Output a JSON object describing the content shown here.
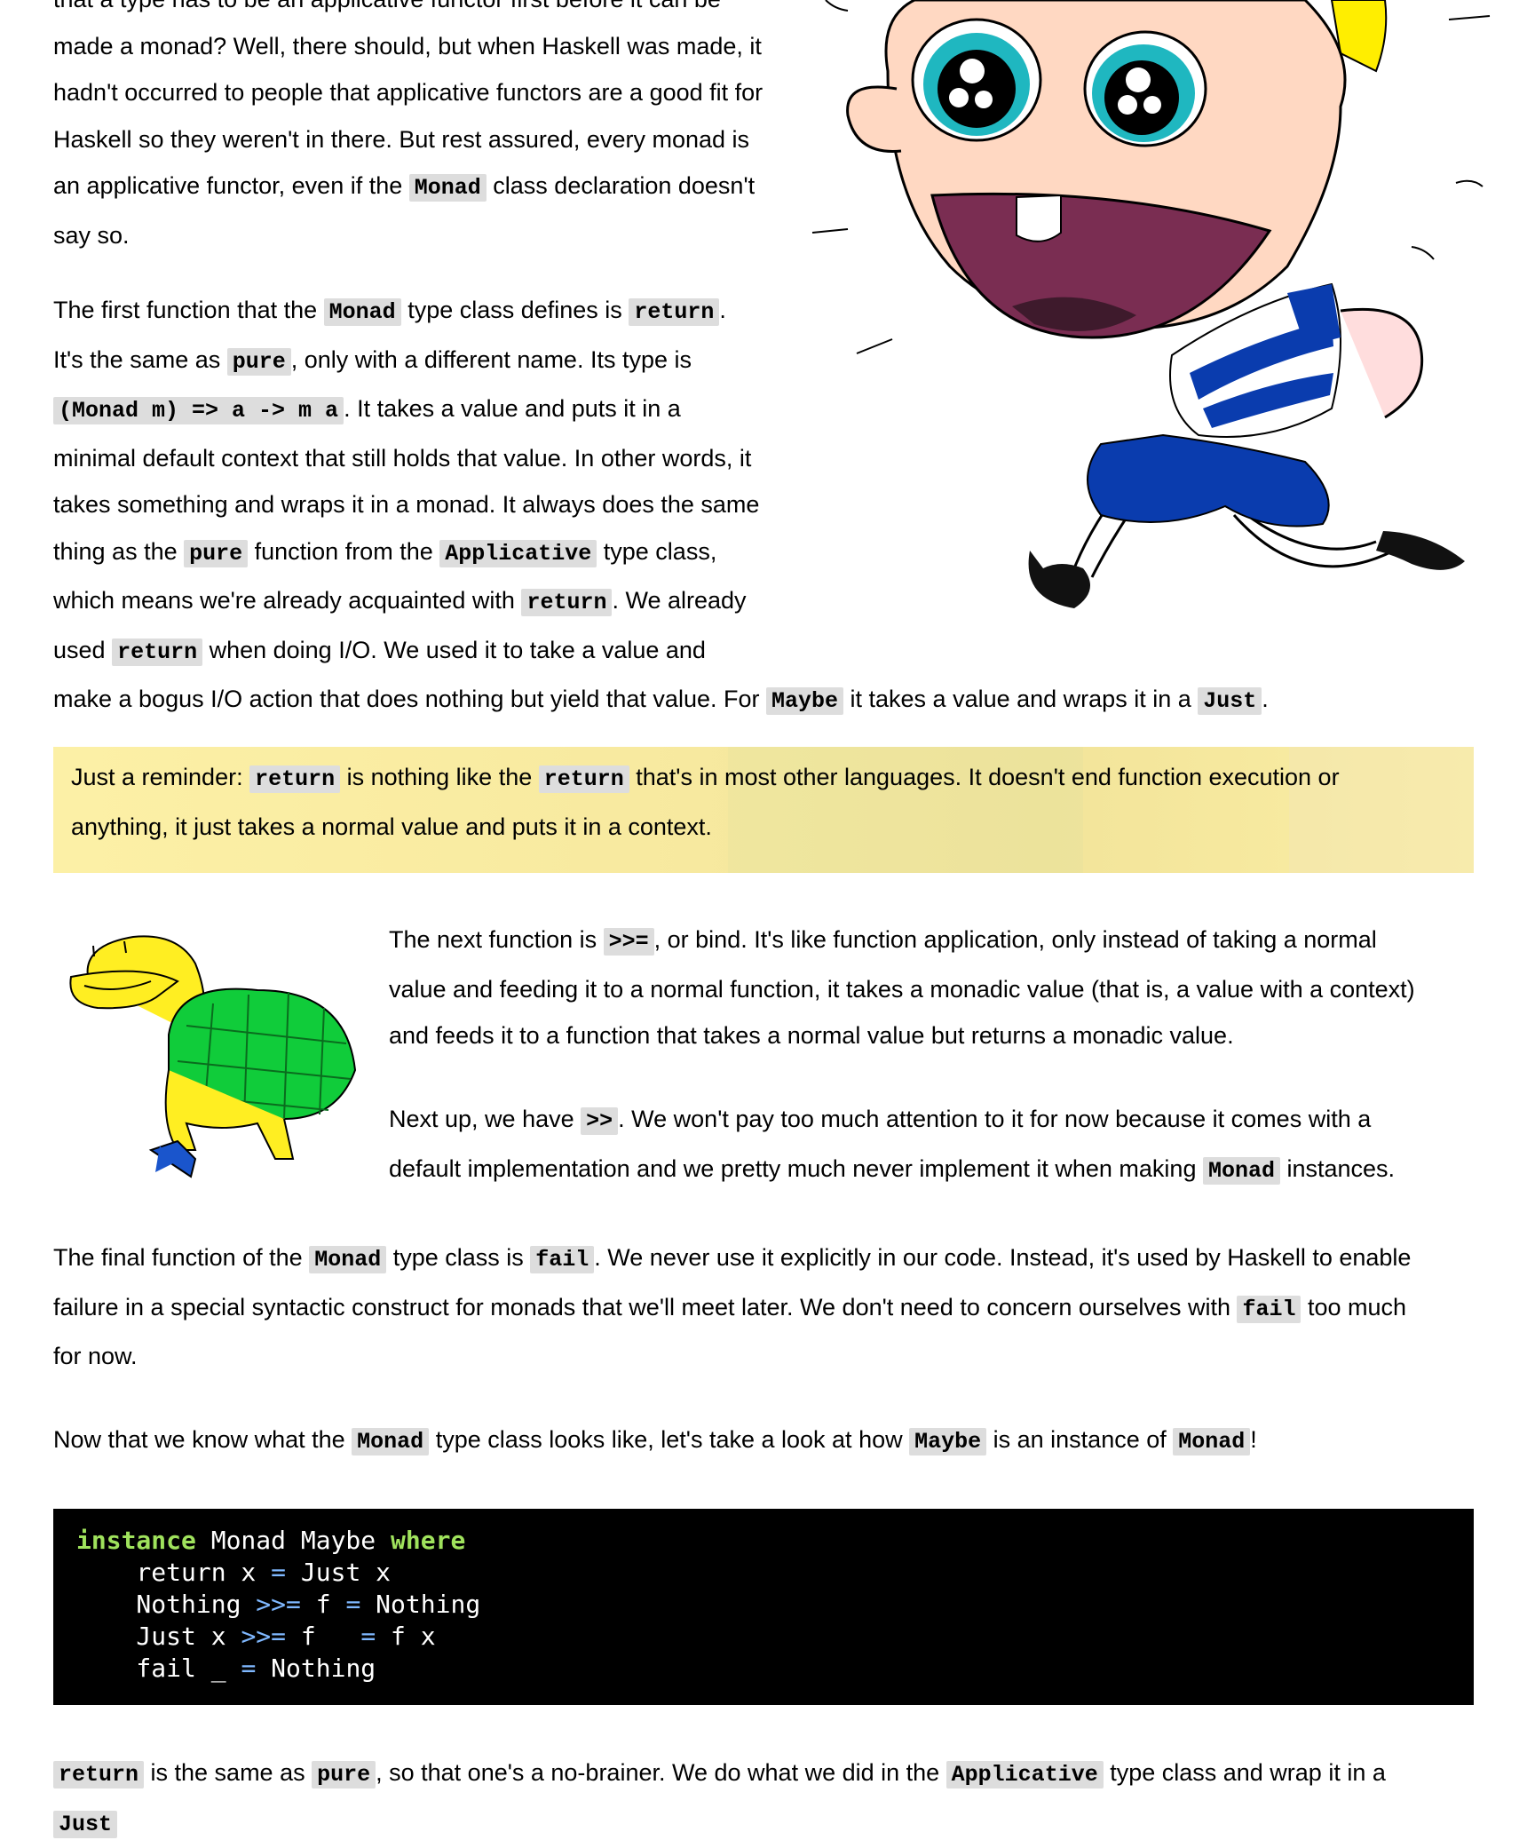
{
  "para1": {
    "line0": "that a type has to be an applicative functor first before it can be",
    "line1": "made a monad? Well, there should, but when Haskell was made, it",
    "line2": "hadn't occurred to people that applicative functors are a good fit for",
    "line3": "Haskell so they weren't in there. But rest assured, every monad is",
    "line4a": "an applicative functor, even if the ",
    "line4code": "Monad",
    "line4b": " class declaration doesn't",
    "line5": "say so."
  },
  "para2": {
    "t1": "The first function that the ",
    "c1": "Monad",
    "t2": " type class defines is ",
    "c2": "return",
    "t3": ".",
    "t4": "It's the same as ",
    "c3": "pure",
    "t5": ", only with a different name. Its type is",
    "c4": "(Monad m) => a -> m a",
    "t6": ". It takes a value and puts it in a",
    "t7": "minimal default context that still holds that value. In other words, it",
    "t8": "takes something and wraps it in a monad. It always does the same",
    "t9": "thing as the ",
    "c5": "pure",
    "t10": " function from the ",
    "c6": "Applicative",
    "t11": " type class,",
    "t12": "which means we're already acquainted with ",
    "c7": "return",
    "t13": ". We already",
    "t14": "used ",
    "c8": "return",
    "t15": " when doing I/O. We used it to take a value and",
    "t16": "make a bogus I/O action that does nothing but yield that value. For ",
    "c9": "Maybe",
    "t17": " it takes a value and wraps it in a ",
    "c10": "Just",
    "t18": "."
  },
  "reminder": {
    "t1": "Just a reminder: ",
    "c1": "return",
    "t2": " is nothing like the ",
    "c2": "return",
    "t3": " that's in most other languages. It doesn't end function execution or",
    "t4": "anything, it just takes a normal value and puts it in a context."
  },
  "para3": {
    "t1": "The next function is ",
    "c1": ">>=",
    "t2": ", or bind. It's like function application, only instead of taking a normal",
    "t3": "value and feeding it to a normal function, it takes a monadic value (that is, a value with a context)",
    "t4": "and feeds it to a function that takes a normal value but returns a monadic value."
  },
  "para4": {
    "t1": "Next up, we have ",
    "c1": ">>",
    "t2": ". We won't pay too much attention to it for now because it comes with a",
    "t3": "default implementation and we pretty much never implement it when making ",
    "c2": "Monad",
    "t4": " instances."
  },
  "para5": {
    "t1": "The final function of the ",
    "c1": "Monad",
    "t2": " type class is ",
    "c2": "fail",
    "t3": ". We never use it explicitly in our code. Instead, it's used by Haskell to enable",
    "t4": "failure in a special syntactic construct for monads that we'll meet later. We don't need to concern ourselves with ",
    "c3": "fail",
    "t5": " too much",
    "t6": "for now."
  },
  "para6": {
    "t1": "Now that we know what the ",
    "c1": "Monad",
    "t2": " type class looks like, let's take a look at how ",
    "c2": "Maybe",
    "t3": " is an instance of ",
    "c3": "Monad",
    "t4": "!"
  },
  "code": {
    "l1_kw1": "instance",
    "l1_mid": " Monad Maybe ",
    "l1_kw2": "where",
    "l2_a": "    return x ",
    "l2_op": "=",
    "l2_b": " Just x",
    "l3_a": "    Nothing ",
    "l3_op1": ">>=",
    "l3_b": " f ",
    "l3_op2": "=",
    "l3_c": " Nothing",
    "l4_a": "    Just x ",
    "l4_op1": ">>=",
    "l4_b": " f   ",
    "l4_op2": "=",
    "l4_c": " f x",
    "l5_a": "    fail _ ",
    "l5_op": "=",
    "l5_b": " Nothing"
  },
  "para7": {
    "c1": "return",
    "t1": " is the same as ",
    "c2": "pure",
    "t2": ", so that one's a no-brainer. We do what we did in the ",
    "c3": "Applicative",
    "t3": " type class and wrap it in a",
    "c4": "Just"
  },
  "colors": {
    "code_bg": "#000000",
    "code_keyword": "#9fe25c",
    "code_operator": "#7fb8ff",
    "inline_code_bg": "#dddddd",
    "reminder_bg": "#fcf0a6"
  }
}
